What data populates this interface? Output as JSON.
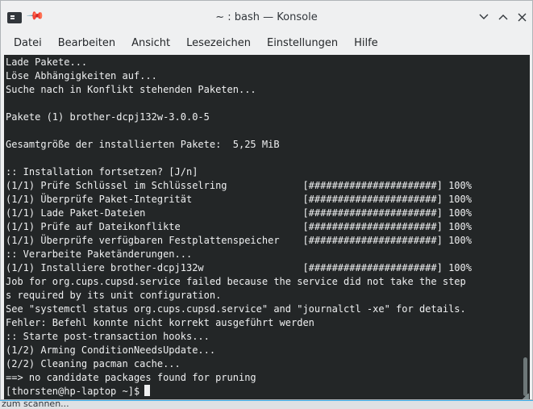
{
  "window": {
    "title": "~ : bash — Konsole",
    "minimize_icon": "chevron-down",
    "maximize_icon": "chevron-up",
    "close_icon": "close"
  },
  "menu": [
    "Datei",
    "Bearbeiten",
    "Ansicht",
    "Lesezeichen",
    "Einstellungen",
    "Hilfe"
  ],
  "terminal": {
    "lines": [
      "Lade Pakete...",
      "Löse Abhängigkeiten auf...",
      "Suche nach in Konflikt stehenden Paketen...",
      "",
      "Pakete (1) brother-dcpj132w-3.0.0-5",
      "",
      "Gesamtgröße der installierten Pakete:  5,25 MiB",
      "",
      ":: Installation fortsetzen? [J/n]",
      "(1/1) Prüfe Schlüssel im Schlüsselring             [######################] 100%",
      "(1/1) Überprüfe Paket-Integrität                   [######################] 100%",
      "(1/1) Lade Paket-Dateien                           [######################] 100%",
      "(1/1) Prüfe auf Dateikonflikte                     [######################] 100%",
      "(1/1) Überprüfe verfügbaren Festplattenspeicher    [######################] 100%",
      ":: Verarbeite Paketänderungen...",
      "(1/1) Installiere brother-dcpj132w                 [######################] 100%",
      "Job for org.cups.cupsd.service failed because the service did not take the step",
      "s required by its unit configuration.",
      "See \"systemctl status org.cups.cupsd.service\" and \"journalctl -xe\" for details.",
      "Fehler: Befehl konnte nicht korrekt ausgeführt werden",
      ":: Starte post-transaction hooks...",
      "(1/2) Arming ConditionNeedsUpdate...",
      "(2/2) Cleaning pacman cache...",
      "==> no candidate packages found for pruning"
    ],
    "prompt": "[thorsten@hp-laptop ~]$"
  },
  "background": {
    "partial_text": "zum scannen..."
  }
}
